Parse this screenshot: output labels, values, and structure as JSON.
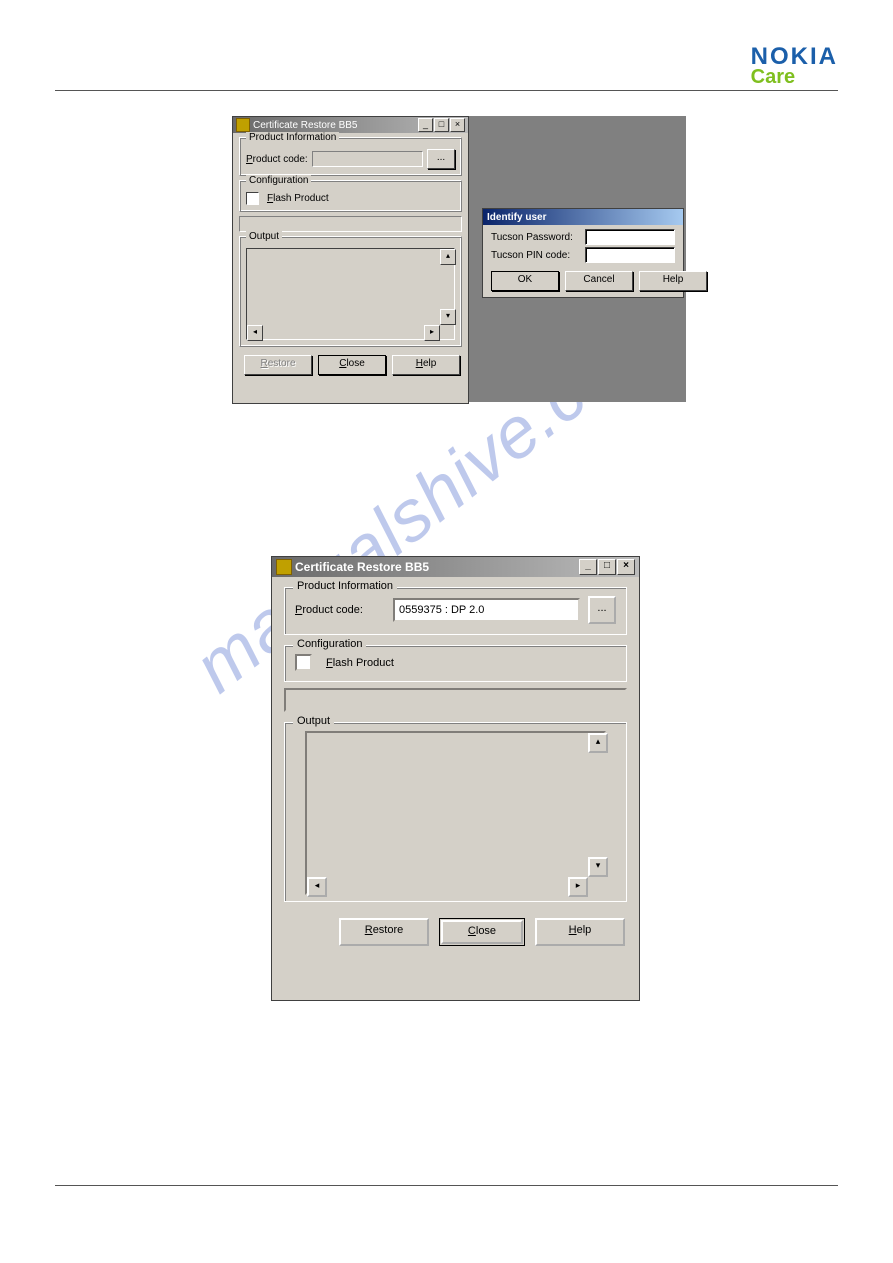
{
  "logo": {
    "brand": "NOKIA",
    "sub": "Care"
  },
  "watermark": "manualshive.com",
  "shot1": {
    "win": {
      "title": "Certificate Restore BB5",
      "product_info_legend": "Product Information",
      "product_code_label_underline": "P",
      "product_code_label_rest": "roduct code:",
      "product_code_value": "",
      "browse": "...",
      "config_legend": "Configuration",
      "flash_underline": "F",
      "flash_rest": "lash Product",
      "output_legend": "Output",
      "restore_underline": "R",
      "restore_rest": "estore",
      "close_underline": "C",
      "close_rest": "lose",
      "help_underline": "H",
      "help_rest": "elp"
    },
    "dlg": {
      "title": "Identify user",
      "pwd_label": "Tucson Password:",
      "pin_label": "Tucson PIN code:",
      "ok": "OK",
      "cancel": "Cancel",
      "help": "Help"
    }
  },
  "shot2": {
    "title": "Certificate Restore BB5",
    "product_info_legend": "Product Information",
    "product_code_label_underline": "P",
    "product_code_label_rest": "roduct code:",
    "product_code_value": "0559375 : DP 2.0",
    "browse": "...",
    "config_legend": "Configuration",
    "flash_underline": "F",
    "flash_rest": "lash Product",
    "output_legend": "Output",
    "restore_underline": "R",
    "restore_rest": "estore",
    "close_underline": "C",
    "close_rest": "lose",
    "help_underline": "H",
    "help_rest": "elp"
  }
}
